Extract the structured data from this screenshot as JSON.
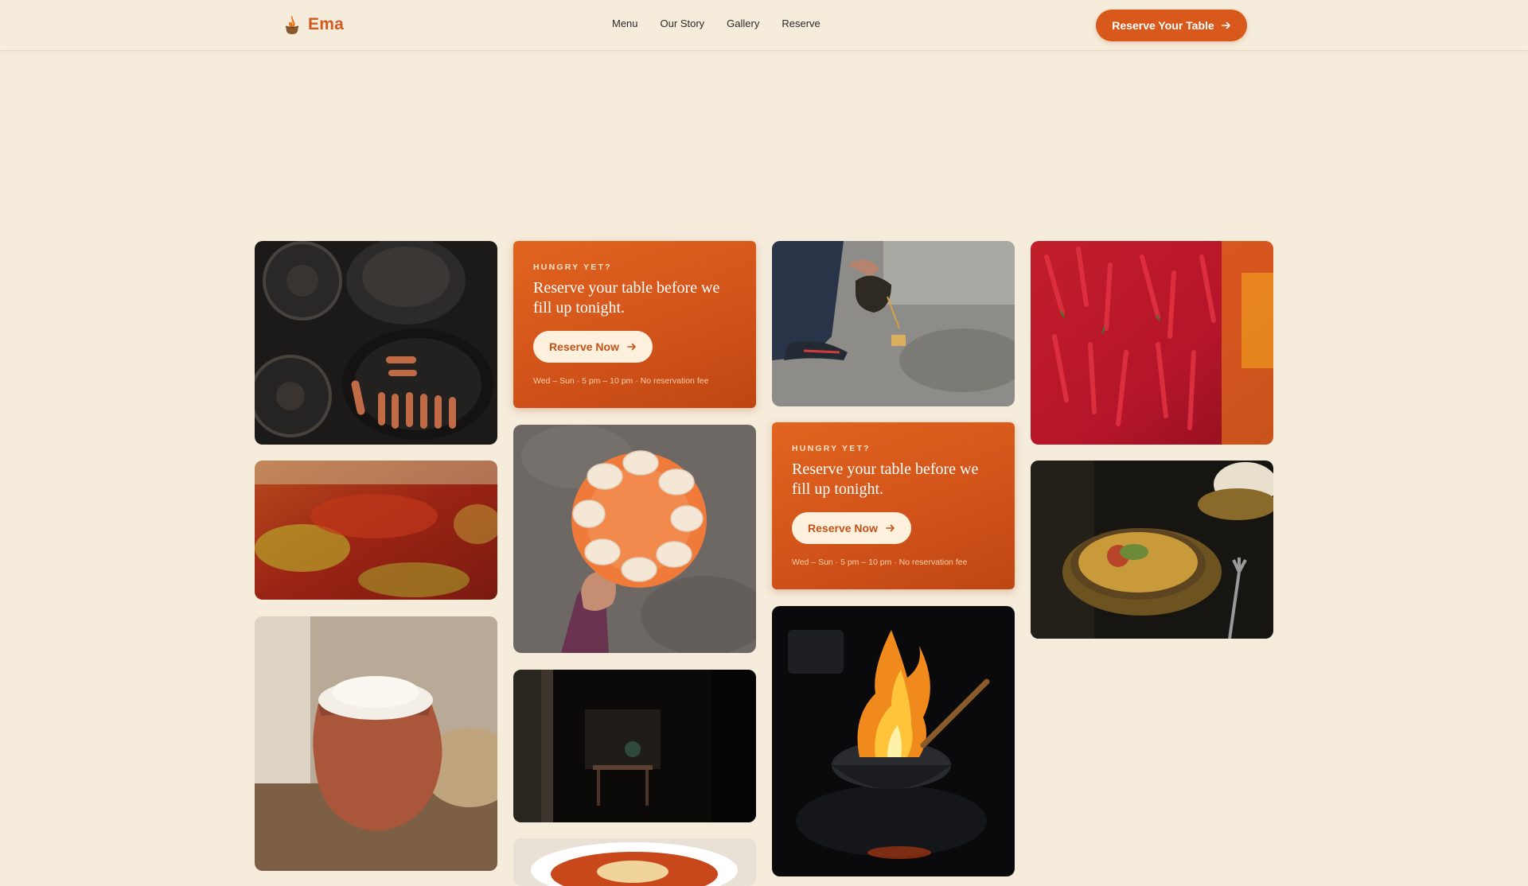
{
  "header": {
    "brand_name": "Ema",
    "brand_icon": "flame-pot-icon",
    "nav": [
      "Menu",
      "Our Story",
      "Gallery",
      "Reserve"
    ],
    "cta_label": "Reserve Your Table",
    "cta_icon": "arrow-right-icon"
  },
  "promo": {
    "eyebrow": "HUNGRY YET?",
    "title": "Reserve your table before we fill up tonight.",
    "button_label": "Reserve Now",
    "button_icon": "arrow-right-icon",
    "note": "Wed – Sun · 5 pm – 10 pm · No reservation fee"
  },
  "colors": {
    "background": "#f5ecdb",
    "accent": "#d9591c",
    "brand": "#d25a1e",
    "promo_button_bg": "#fdf0dc"
  }
}
